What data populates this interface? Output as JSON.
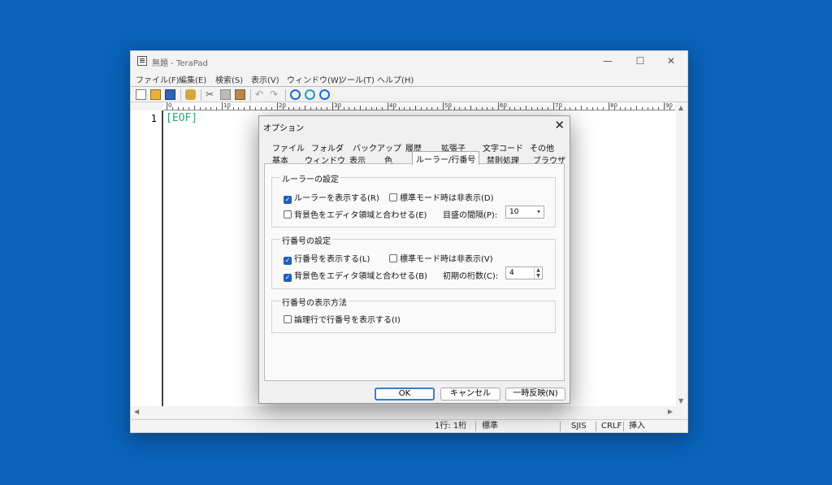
{
  "window": {
    "title": "無題 - TeraPad",
    "min": "—",
    "max": "☐",
    "close": "✕"
  },
  "menu": [
    "ファイル(F)",
    "編集(E)",
    "検索(S)",
    "表示(V)",
    "ウィンドウ(W)",
    "ツール(T)",
    "ヘルプ(H)"
  ],
  "toolbar_icons": [
    "new-file-icon",
    "open-folder-icon",
    "save-icon",
    "print-icon",
    "cut-icon",
    "copy-icon",
    "paste-icon",
    "undo-icon",
    "redo-icon",
    "find-icon",
    "find-next-icon",
    "find-prev-icon"
  ],
  "ruler_labels": [
    "0",
    "10",
    "20",
    "30",
    "40",
    "50",
    "60",
    "70",
    "80",
    "90"
  ],
  "editor": {
    "line_number": "1",
    "eof": "[EOF]"
  },
  "status": {
    "pos": "1行: 1桁",
    "mode": "標準",
    "encoding": "SJIS",
    "newline": "CRLF",
    "insert": "挿入"
  },
  "dialog": {
    "title": "オプション",
    "tabs_row1": [
      "ファイル",
      "フォルダ",
      "バックアップ",
      "履歴",
      "拡張子",
      "文字コード",
      "その他"
    ],
    "tabs_row2": [
      "基本",
      "ウィンドウ",
      "表示",
      "色",
      "ルーラー/行番号",
      "禁則処理",
      "ブラウザ"
    ],
    "ruler_group": {
      "label": "ルーラーの設定",
      "show_ruler": "ルーラーを表示する(R)",
      "hide_std": "標準モード時は非表示(D)",
      "bg_match": "背景色をエディタ領域と合わせる(E)",
      "interval_label": "目盛の間隔(P):",
      "interval_value": "10"
    },
    "line_group": {
      "label": "行番号の設定",
      "show_line": "行番号を表示する(L)",
      "hide_std": "標準モード時は非表示(V)",
      "bg_match": "背景色をエディタ領域と合わせる(B)",
      "digits_label": "初期の桁数(C):",
      "digits_value": "4"
    },
    "display_group": {
      "label": "行番号の表示方法",
      "logical": "論理行で行番号を表示する(I)"
    },
    "buttons": {
      "ok": "OK",
      "cancel": "キャンセル",
      "apply": "一時反映(N)"
    }
  }
}
